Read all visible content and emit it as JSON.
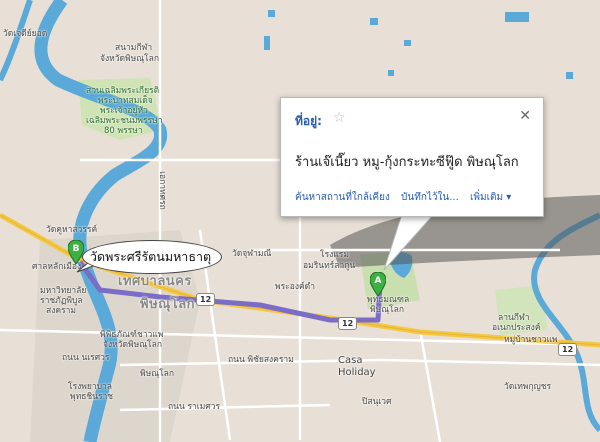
{
  "map": {
    "labels": {
      "wat_chedi_yot": "วัดเจดีย์ยอด",
      "sanam_kila": "สนามกีฬา",
      "sanam_kila_prov": "จังหวัดพิษณุโลก",
      "park_1": "สวนเฉลิมพระเกียรติ",
      "park_2": "พระบาทสมเด็จ",
      "park_3": "พระเจ้าอยู่หัว",
      "park_4": "เฉลิมพระชนมพรรษา",
      "park_5": "80 พรรษา",
      "wat_khuha": "วัดคูหาสวรรค์",
      "san_lak": "ศาลหลักเมือง",
      "uni_1": "มหาวิทยาลัย",
      "uni_2": "ราชภัฏพิบูล",
      "uni_3": "สงคราม",
      "district_1": "เทศบาลนคร",
      "district_2": "พิษณุโลก",
      "museum_1": "พิพิธภัณฑ์ชาวแพ",
      "museum_2": "จังหวัดพิษณุโลก",
      "thanon_naresuan": "ถนน นเรศวร",
      "hospital_1": "โรงพยาบาล",
      "hospital_2": "พุทธชินราช",
      "thanon_ramesuan": "ถนน ราเมศวร",
      "phitsanulok_center": "พิษณุโลก",
      "thanon_phichai": "ถนน พิชัยสงคราม",
      "casa_1": "Casa",
      "casa_2": "Holiday",
      "ronghaem_1": "โรงแรม",
      "ronghaem_2": "อมรินทร์ลากูน",
      "wat_chulamani": "วัดจุฬามณี",
      "phra_ong": "พระองค์ดำ",
      "phutthamonthon_1": "พุทธมณฑล",
      "phutthamonthon_2": "พิษณุโลก",
      "lan_kila_1": "ลานกีฬา",
      "lan_kila_2": "อเนกประสงค์",
      "mu_ban": "หมู่บ้านชาวแพ",
      "wat_thepkrachang": "วัดเทพกุญชร",
      "ekathotsarot": "เอกาทศรถ",
      "pisanuwet": "ปิสนุเวศ"
    },
    "route_shields": [
      "12",
      "12",
      "12"
    ],
    "marker_a": "A",
    "marker_b": "B",
    "bubble_b": "วัดพระศรีรัตนมหาธาตุ"
  },
  "infowindow": {
    "title": "ที่อยู่:",
    "name": "ร้านเจ๊เนี๊ยว หมู-กุ้งกระทะซีฟู๊ด พิษณุโลก",
    "links": [
      "ค้นหาสถานที่ใกล้เคียง",
      "บันทึกไว้ใน...",
      "เพิ่มเติม ▾"
    ]
  },
  "colors": {
    "route": "#7b6cc8",
    "river": "#5aa9d8",
    "highway": "#f5c842",
    "park": "#c9dfb0",
    "land": "#e8e0d6",
    "link": "#2a5db0"
  },
  "icons": {
    "star": "star-icon",
    "close": "close-icon"
  }
}
